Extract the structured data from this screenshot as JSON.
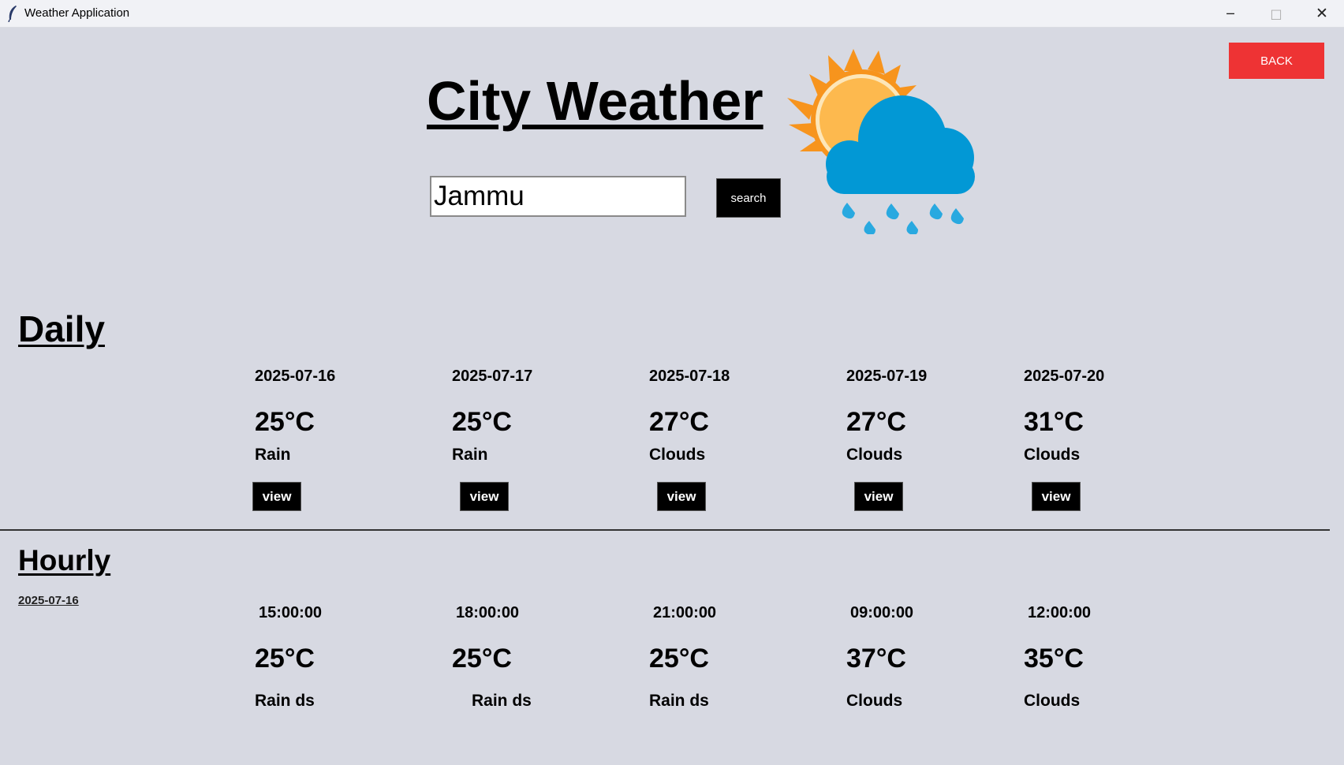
{
  "window": {
    "title": "Weather Application",
    "minimize": "─",
    "maximize": "□",
    "close": "✕"
  },
  "header": {
    "back_label": "BACK",
    "title": "City Weather",
    "city_value": "Jammu",
    "search_label": "search",
    "weather_icon": "sun-cloud-rain-icon"
  },
  "daily": {
    "title": "Daily",
    "days": [
      {
        "date": "2025-07-16",
        "temp": "25°C",
        "condition": "Rain",
        "button": "view"
      },
      {
        "date": "2025-07-17",
        "temp": "25°C",
        "condition": "Rain",
        "button": "view"
      },
      {
        "date": "2025-07-18",
        "temp": "27°C",
        "condition": "Clouds",
        "button": "view"
      },
      {
        "date": "2025-07-19",
        "temp": "27°C",
        "condition": "Clouds",
        "button": "view"
      },
      {
        "date": "2025-07-20",
        "temp": "31°C",
        "condition": "Clouds",
        "button": "view"
      }
    ]
  },
  "hourly": {
    "title": "Hourly",
    "date": "2025-07-16",
    "hours": [
      {
        "time": "15:00:00",
        "temp": "25°C",
        "condition": "Rain ds"
      },
      {
        "time": "18:00:00",
        "temp": "25°C",
        "condition": "Rain ds"
      },
      {
        "time": "21:00:00",
        "temp": "25°C",
        "condition": "Rain ds"
      },
      {
        "time": "09:00:00",
        "temp": "37°C",
        "condition": "Clouds"
      },
      {
        "time": "12:00:00",
        "temp": "35°C",
        "condition": "Clouds"
      }
    ]
  },
  "colors": {
    "background": "#d7d9e2",
    "back_button": "#ee3334",
    "sun": "#f7941d",
    "cloud": "#0298d5",
    "rain": "#29a9e0"
  }
}
